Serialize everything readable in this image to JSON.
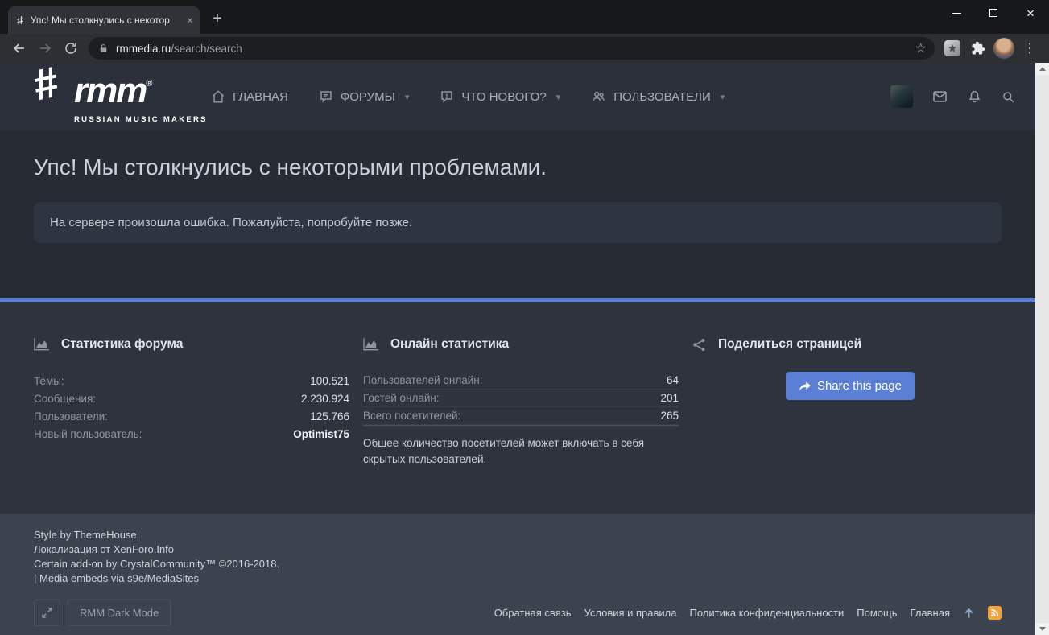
{
  "colors": {
    "accent_blue": "#5b7fd4",
    "divider_blue": "#5b7ed8",
    "rss_orange": "#f1a33c",
    "header_bg": "#2b303a",
    "main_bg": "#262b34",
    "stats_bg": "#2e333e",
    "footer_bg": "#3d434e",
    "error_box_bg": "#2f3540"
  },
  "icons": {
    "close": "×",
    "plus": "+",
    "kebab": "⋮",
    "star": "☆",
    "chevron_down": "▾",
    "favicon": "#"
  },
  "browser": {
    "tab": {
      "title": "Упс! Мы столкнулись с некотор"
    },
    "url": {
      "domain": "rmmedia.ru",
      "path": "/search/search"
    }
  },
  "header": {
    "logo": {
      "hash": "#",
      "text": "rmm",
      "reg": "®",
      "subtitle": "RUSSIAN MUSIC MAKERS"
    },
    "nav": [
      {
        "label": "ГЛАВНАЯ"
      },
      {
        "label": "ФОРУМЫ"
      },
      {
        "label": "ЧТО НОВОГО?"
      },
      {
        "label": "ПОЛЬЗОВАТЕЛИ"
      }
    ]
  },
  "main": {
    "title": "Упс! Мы столкнулись с некоторыми проблемами.",
    "error_message": "На сервере произошла ошибка. Пожалуйста, попробуйте позже."
  },
  "stats": {
    "forum": {
      "title": "Статистика форума",
      "rows": [
        {
          "label": "Темы:",
          "value": "100.521"
        },
        {
          "label": "Сообщения:",
          "value": "2.230.924"
        },
        {
          "label": "Пользователи:",
          "value": "125.766"
        },
        {
          "label": "Новый пользователь:",
          "value": "Optimist75"
        }
      ]
    },
    "online": {
      "title": "Онлайн статистика",
      "rows": [
        {
          "label": "Пользователей онлайн:",
          "value": "64"
        },
        {
          "label": "Гостей онлайн:",
          "value": "201"
        },
        {
          "label": "Всего посетителей:",
          "value": "265"
        }
      ],
      "note": "Общее количество посетителей может включать в себя скрытых пользователей."
    },
    "share": {
      "title": "Поделиться страницей",
      "button_label": "Share this page"
    }
  },
  "footer": {
    "credits": [
      "Style by ThemeHouse",
      "Локализация от XenForo.Info",
      "Certain add-on by CrystalCommunity™ ©2016-2018.",
      "| Media embeds via s9e/MediaSites"
    ],
    "dark_mode_label": "RMM Dark Mode",
    "links": [
      "Обратная связь",
      "Условия и правила",
      "Политика конфиденциальности",
      "Помощь",
      "Главная"
    ]
  }
}
